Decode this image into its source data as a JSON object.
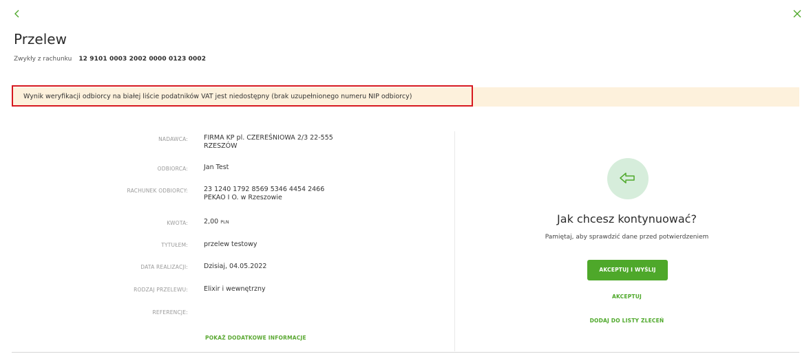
{
  "header": {
    "title": "Przelew",
    "subtitle_label": "Zwykły z rachunku",
    "account_number": "12 9101 0003 2002 0000 0123 0002",
    "back_icon": "chevron-left-icon",
    "close_icon": "close-icon"
  },
  "banner": {
    "text": "Wynik weryfikacji odbiorcy na białej liście podatników VAT jest niedostępny (brak uzupełnionego numeru NIP odbiorcy)",
    "background": "#fdf1dc",
    "highlight_border": "#d6181f"
  },
  "details": {
    "sender_label": "NADAWCA:",
    "sender_line1": "FIRMA KP pl. CZEREŚNIOWA 2/3 22-555",
    "sender_line2": "RZESZÓW",
    "recipient_label": "ODBIORCA:",
    "recipient_value": "Jan Test",
    "account_label": "RACHUNEK ODBIORCY:",
    "account_line1": "23 1240 1792 8569 5346 4454 2466",
    "account_line2": "PEKAO I O. w Rzeszowie",
    "amount_label": "KWOTA:",
    "amount_value": "2,00",
    "amount_currency": "PLN",
    "title_label": "TYTUŁEM:",
    "title_value": "przelew testowy",
    "date_label": "DATA REALIZACJI:",
    "date_value": "Dzisiaj, 04.05.2022",
    "type_label": "RODZAJ PRZELEWU:",
    "type_value": "Elixir i wewnętrzny",
    "reference_label": "REFERENCJE:",
    "reference_value": "",
    "more_link": "POKAŻ DODATKOWE INFORMACJE"
  },
  "actions": {
    "icon": "reply-arrow-icon",
    "question": "Jak chcesz kontynuować?",
    "hint": "Pamiętaj, aby sprawdzić dane przed potwierdzeniem",
    "accept_send": "AKCEPTUJ I WYŚLIJ",
    "accept": "AKCEPTUJ",
    "add_to_list": "DODAJ DO LISTY ZLECEŃ",
    "accent_color": "#4ea82a"
  }
}
